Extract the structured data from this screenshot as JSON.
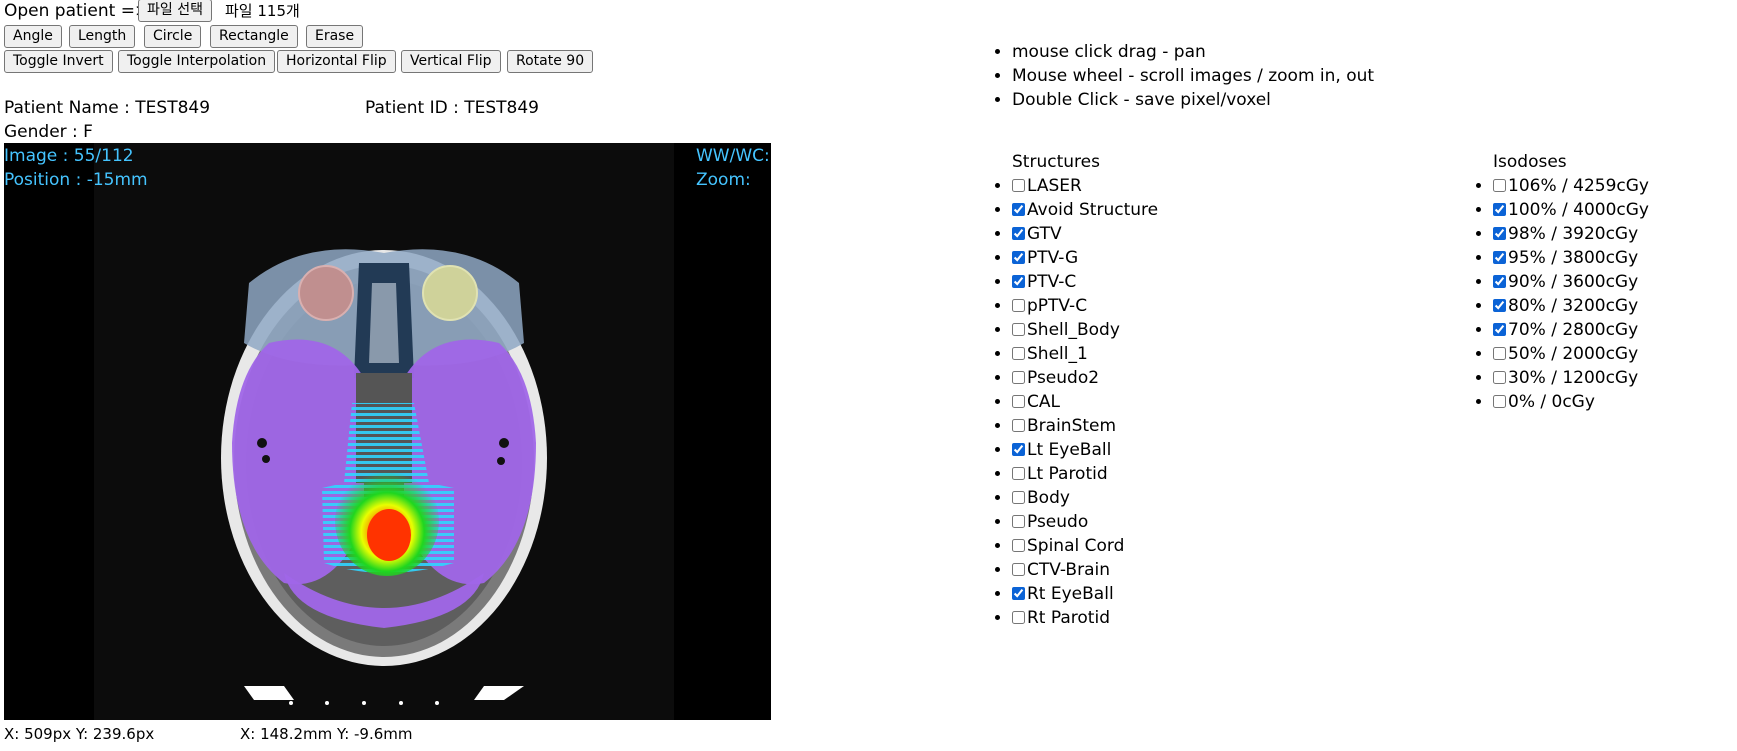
{
  "open_patient": {
    "label": "Open patient =>",
    "file_button": "파일 선택",
    "file_status": "파일 115개"
  },
  "tools": [
    "Angle",
    "Length",
    "Circle",
    "Rectangle",
    "Erase"
  ],
  "view_buttons": [
    "Toggle Invert",
    "Toggle Interpolation",
    "Horizontal Flip",
    "Vertical Flip",
    "Rotate 90"
  ],
  "patient": {
    "name_label": "Patient Name : TEST849",
    "id_label": "Patient ID : TEST849",
    "gender_label": "Gender : F"
  },
  "viewer": {
    "image_label": "Image : 55/112",
    "position_label": "Position : -15mm",
    "wwwc_label": "WW/WC:",
    "zoom_label": "Zoom:",
    "accent_color": "#45c4ff"
  },
  "coords": {
    "pixel": "X: 509px Y: 239.6px",
    "mm": "X: 148.2mm Y: -9.6mm"
  },
  "help": [
    "mouse click drag - pan",
    "Mouse wheel - scroll images / zoom in, out",
    "Double Click - save pixel/voxel"
  ],
  "structures": {
    "title": "Structures",
    "items": [
      {
        "label": "LASER",
        "checked": false
      },
      {
        "label": "Avoid Structure",
        "checked": true
      },
      {
        "label": "GTV",
        "checked": true
      },
      {
        "label": "PTV-G",
        "checked": true
      },
      {
        "label": "PTV-C",
        "checked": true
      },
      {
        "label": "pPTV-C",
        "checked": false
      },
      {
        "label": "Shell_Body",
        "checked": false
      },
      {
        "label": "Shell_1",
        "checked": false
      },
      {
        "label": "Pseudo2",
        "checked": false
      },
      {
        "label": "CAL",
        "checked": false
      },
      {
        "label": "BrainStem",
        "checked": false
      },
      {
        "label": "Lt EyeBall",
        "checked": true
      },
      {
        "label": "Lt Parotid",
        "checked": false
      },
      {
        "label": "Body",
        "checked": false
      },
      {
        "label": "Pseudo",
        "checked": false
      },
      {
        "label": "Spinal Cord",
        "checked": false
      },
      {
        "label": "CTV-Brain",
        "checked": false
      },
      {
        "label": "Rt EyeBall",
        "checked": true
      },
      {
        "label": "Rt Parotid",
        "checked": false
      }
    ]
  },
  "isodoses": {
    "title": "Isodoses",
    "items": [
      {
        "label": "106% / 4259cGy",
        "checked": false
      },
      {
        "label": "100% / 4000cGy",
        "checked": true
      },
      {
        "label": "98% / 3920cGy",
        "checked": true
      },
      {
        "label": "95% / 3800cGy",
        "checked": true
      },
      {
        "label": "90% / 3600cGy",
        "checked": true
      },
      {
        "label": "80% / 3200cGy",
        "checked": true
      },
      {
        "label": "70% / 2800cGy",
        "checked": true
      },
      {
        "label": "50% / 2000cGy",
        "checked": false
      },
      {
        "label": "30% / 1200cGy",
        "checked": false
      },
      {
        "label": "0% / 0cGy",
        "checked": false
      }
    ]
  }
}
